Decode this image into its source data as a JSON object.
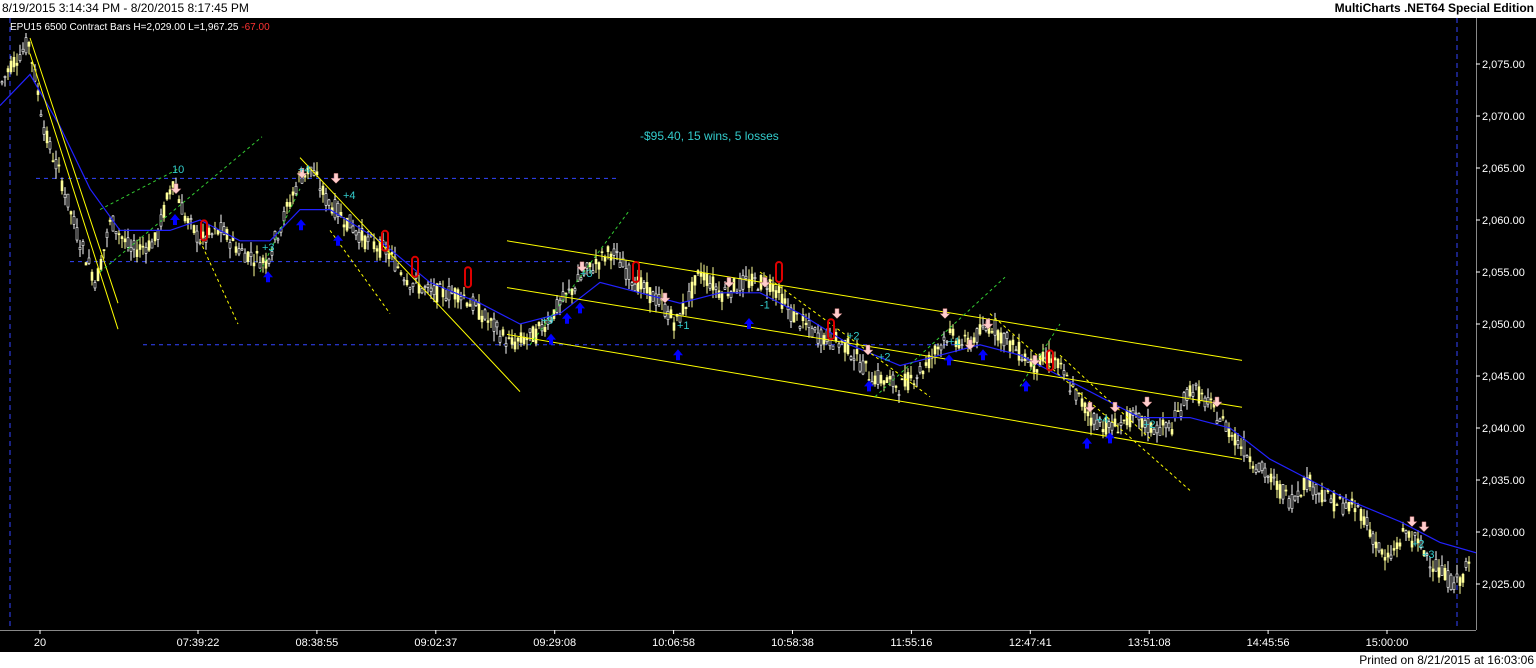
{
  "header": {
    "range": "8/19/2015 3:14:34 PM - 8/20/2015 8:17:45 PM",
    "app_title": "MultiCharts .NET64 Special Edition"
  },
  "footer": {
    "printed": "Printed on 8/21/2015 at 16:03:06"
  },
  "info": {
    "symbol": "EPU15",
    "bars": "6500 Contract Bars",
    "high": "H=2,029.00",
    "low": "L=1,967.25",
    "change": "-67.00"
  },
  "strategy_summary": "-$95.40, 15 wins, 5 losses",
  "colors": {
    "background": "#000000",
    "up_candle": "#ffffff",
    "down_candle": "#ffff99",
    "moving_average": "#2222ff",
    "channel": "#ffff00",
    "dashed_green": "#33cc33",
    "dashed_blue": "#3344ff",
    "entry_arrow": "#0000ff",
    "exit_arrow": "#ffcccc",
    "exit_marker": "#dd0000",
    "trade_label": "#33cccc",
    "axis_text": "#ffffff",
    "change_text": "#ff3333"
  },
  "chart_data": {
    "type": "candlestick",
    "ylim": [
      2022.5,
      2077.5
    ],
    "y_ticks": [
      {
        "value": 2025,
        "label": "2,025.00"
      },
      {
        "value": 2030,
        "label": "2,030.00"
      },
      {
        "value": 2035,
        "label": "2,035.00"
      },
      {
        "value": 2040,
        "label": "2,040.00"
      },
      {
        "value": 2045,
        "label": "2,045.00"
      },
      {
        "value": 2050,
        "label": "2,050.00"
      },
      {
        "value": 2055,
        "label": "2,055.00"
      },
      {
        "value": 2060,
        "label": "2,060.00"
      },
      {
        "value": 2065,
        "label": "2,065.00"
      },
      {
        "value": 2070,
        "label": "2,070.00"
      },
      {
        "value": 2075,
        "label": "2,075.00"
      }
    ],
    "x_labels": [
      "20",
      "07:39:22",
      "08:38:55",
      "09:02:37",
      "09:29:08",
      "10:06:58",
      "10:58:38",
      "11:55:16",
      "12:47:41",
      "13:51:08",
      "14:45:56",
      "15:00:00"
    ],
    "price_path": [
      [
        0,
        2073
      ],
      [
        10,
        2075
      ],
      [
        28,
        2077
      ],
      [
        45,
        2068
      ],
      [
        60,
        2064
      ],
      [
        75,
        2059
      ],
      [
        95,
        2054
      ],
      [
        110,
        2060
      ],
      [
        130,
        2057
      ],
      [
        155,
        2058
      ],
      [
        172,
        2064
      ],
      [
        185,
        2060
      ],
      [
        200,
        2058
      ],
      [
        220,
        2059
      ],
      [
        240,
        2057
      ],
      [
        265,
        2056
      ],
      [
        282,
        2060
      ],
      [
        298,
        2064
      ],
      [
        310,
        2065
      ],
      [
        325,
        2062
      ],
      [
        345,
        2060
      ],
      [
        365,
        2058
      ],
      [
        385,
        2057
      ],
      [
        410,
        2054
      ],
      [
        430,
        2053
      ],
      [
        460,
        2053
      ],
      [
        480,
        2051
      ],
      [
        510,
        2048
      ],
      [
        535,
        2049
      ],
      [
        560,
        2052
      ],
      [
        585,
        2055
      ],
      [
        610,
        2057
      ],
      [
        635,
        2054
      ],
      [
        660,
        2052
      ],
      [
        675,
        2050
      ],
      [
        700,
        2055
      ],
      [
        720,
        2053
      ],
      [
        745,
        2054
      ],
      [
        770,
        2054
      ],
      [
        790,
        2051
      ],
      [
        815,
        2049
      ],
      [
        845,
        2048
      ],
      [
        870,
        2045
      ],
      [
        900,
        2044
      ],
      [
        925,
        2046
      ],
      [
        945,
        2049
      ],
      [
        965,
        2048
      ],
      [
        990,
        2050
      ],
      [
        1010,
        2048
      ],
      [
        1035,
        2046
      ],
      [
        1050,
        2047
      ],
      [
        1070,
        2044
      ],
      [
        1090,
        2041
      ],
      [
        1110,
        2040
      ],
      [
        1130,
        2041
      ],
      [
        1150,
        2040
      ],
      [
        1170,
        2040
      ],
      [
        1190,
        2044
      ],
      [
        1210,
        2042
      ],
      [
        1235,
        2039
      ],
      [
        1260,
        2036
      ],
      [
        1290,
        2033
      ],
      [
        1305,
        2035
      ],
      [
        1330,
        2033
      ],
      [
        1360,
        2032
      ],
      [
        1385,
        2027
      ],
      [
        1405,
        2030
      ],
      [
        1425,
        2028
      ],
      [
        1440,
        2026
      ],
      [
        1455,
        2025
      ],
      [
        1470,
        2027
      ]
    ],
    "moving_average": [
      [
        0,
        2071
      ],
      [
        30,
        2074
      ],
      [
        60,
        2069
      ],
      [
        90,
        2063
      ],
      [
        120,
        2059
      ],
      [
        170,
        2059
      ],
      [
        200,
        2060
      ],
      [
        240,
        2058
      ],
      [
        270,
        2058
      ],
      [
        300,
        2061
      ],
      [
        330,
        2061
      ],
      [
        380,
        2058
      ],
      [
        430,
        2054
      ],
      [
        480,
        2052
      ],
      [
        520,
        2050
      ],
      [
        560,
        2051
      ],
      [
        600,
        2054
      ],
      [
        640,
        2053
      ],
      [
        680,
        2052
      ],
      [
        720,
        2053
      ],
      [
        760,
        2053
      ],
      [
        800,
        2051
      ],
      [
        850,
        2048
      ],
      [
        900,
        2046
      ],
      [
        940,
        2047
      ],
      [
        980,
        2048
      ],
      [
        1020,
        2047
      ],
      [
        1060,
        2045
      ],
      [
        1100,
        2043
      ],
      [
        1140,
        2041
      ],
      [
        1190,
        2041
      ],
      [
        1230,
        2040
      ],
      [
        1270,
        2037
      ],
      [
        1310,
        2035
      ],
      [
        1350,
        2033
      ],
      [
        1400,
        2031
      ],
      [
        1440,
        2029
      ],
      [
        1476,
        2028
      ]
    ],
    "channel_lines": [
      [
        [
          507,
          2058
        ],
        [
          1242,
          2046.5
        ]
      ],
      [
        [
          507,
          2053.5
        ],
        [
          1242,
          2042
        ]
      ],
      [
        [
          507,
          2049
        ],
        [
          1242,
          2037
        ]
      ],
      [
        [
          30,
          2076
        ],
        [
          118,
          2049.5
        ]
      ],
      [
        [
          30,
          2077.5
        ],
        [
          118,
          2052
        ]
      ],
      [
        [
          300,
          2066
        ],
        [
          520,
          2043.5
        ]
      ]
    ],
    "dashed_green_lines": [
      [
        [
          100,
          2055
        ],
        [
          262,
          2068
        ]
      ],
      [
        [
          100,
          2061
        ],
        [
          180,
          2065
        ]
      ],
      [
        [
          260,
          2055
        ],
        [
          300,
          2063
        ]
      ],
      [
        [
          530,
          2048
        ],
        [
          630,
          2061
        ]
      ],
      [
        [
          875,
          2043
        ],
        [
          1005,
          2054.5
        ]
      ],
      [
        [
          1020,
          2044
        ],
        [
          1060,
          2050
        ]
      ]
    ],
    "dashed_yellow_lines": [
      [
        [
          200,
          2058
        ],
        [
          238,
          2050
        ]
      ],
      [
        [
          330,
          2059
        ],
        [
          390,
          2051
        ]
      ],
      [
        [
          760,
          2055
        ],
        [
          930,
          2043
        ]
      ],
      [
        [
          990,
          2051
        ],
        [
          1190,
          2034
        ]
      ],
      [
        [
          1060,
          2047
        ],
        [
          1150,
          2039
        ]
      ]
    ],
    "horizontal_levels": [
      {
        "value": 2064,
        "x0": 36,
        "x1": 616
      },
      {
        "value": 2056,
        "x0": 70,
        "x1": 570
      },
      {
        "value": 2048,
        "x0": 143,
        "x1": 960
      }
    ],
    "session_markers_x": [
      10,
      1457
    ],
    "entry_arrows": [
      [
        175,
        2060
      ],
      [
        268,
        2054.5
      ],
      [
        301,
        2059.5
      ],
      [
        338,
        2058
      ],
      [
        551,
        2048.5
      ],
      [
        567,
        2050.5
      ],
      [
        580,
        2051.5
      ],
      [
        678,
        2047
      ],
      [
        749,
        2050
      ],
      [
        869,
        2044
      ],
      [
        949,
        2046.5
      ],
      [
        983,
        2047
      ],
      [
        1026,
        2044
      ],
      [
        1087,
        2038.5
      ],
      [
        1110,
        2039
      ]
    ],
    "exit_arrows": [
      [
        176,
        2063
      ],
      [
        302,
        2064.5
      ],
      [
        336,
        2064
      ],
      [
        582,
        2055.5
      ],
      [
        665,
        2052.5
      ],
      [
        729,
        2054
      ],
      [
        765,
        2054
      ],
      [
        837,
        2051
      ],
      [
        868,
        2047.5
      ],
      [
        945,
        2051
      ],
      [
        970,
        2048
      ],
      [
        988,
        2050
      ],
      [
        1035,
        2046.5
      ],
      [
        1090,
        2042
      ],
      [
        1115,
        2042
      ],
      [
        1147,
        2042.5
      ],
      [
        1217,
        2042.5
      ],
      [
        1412,
        2031
      ],
      [
        1424,
        2030.5
      ]
    ],
    "exit_markers": [
      [
        204,
        2059
      ],
      [
        385,
        2058
      ],
      [
        415,
        2055.5
      ],
      [
        468,
        2054.5
      ],
      [
        636,
        2055
      ],
      [
        779,
        2055
      ],
      [
        831,
        2049.5
      ],
      [
        1050,
        2046.5
      ]
    ],
    "trade_labels": [
      {
        "x": 172,
        "y": 2064.5,
        "text": "10"
      },
      {
        "x": 262,
        "y": 2057,
        "text": "+3"
      },
      {
        "x": 298,
        "y": 2064.5,
        "text": "+4"
      },
      {
        "x": 343,
        "y": 2062,
        "text": "+4"
      },
      {
        "x": 541,
        "y": 2050,
        "text": "+9"
      },
      {
        "x": 580,
        "y": 2054.5,
        "text": "+3"
      },
      {
        "x": 677,
        "y": 2049.5,
        "text": "+1"
      },
      {
        "x": 760,
        "y": 2051.5,
        "text": "-1"
      },
      {
        "x": 847,
        "y": 2048.5,
        "text": "+2"
      },
      {
        "x": 878,
        "y": 2046.5,
        "text": "+2"
      },
      {
        "x": 948,
        "y": 2048,
        "text": "+1"
      },
      {
        "x": 1096,
        "y": 2040.5,
        "text": "+4"
      },
      {
        "x": 1143,
        "y": 2040,
        "text": "+2"
      },
      {
        "x": 1412,
        "y": 2028.5,
        "text": "+2"
      },
      {
        "x": 1422,
        "y": 2027.5,
        "text": "+3"
      }
    ]
  }
}
